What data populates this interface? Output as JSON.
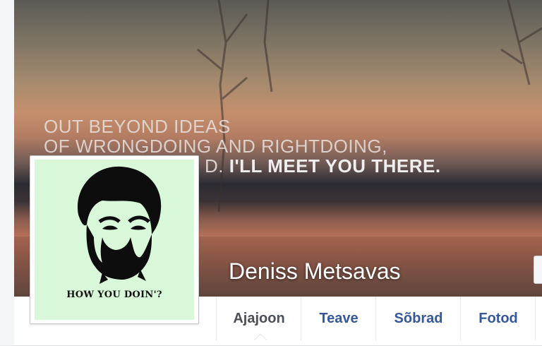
{
  "cover": {
    "quote_line_1": "OUT BEYOND IDEAS",
    "quote_line_2": "OF WRONGDOING AND RIGHTDOING,",
    "quote_line_3_faded": "D.",
    "quote_line_3_bold": "I'LL MEET YOU THERE."
  },
  "profile": {
    "name": "Deniss Metsavas",
    "avatar_caption": "HOW YOU DOIN'?"
  },
  "tabs": [
    {
      "label": "Ajajoon",
      "active": true
    },
    {
      "label": "Teave",
      "active": false
    },
    {
      "label": "Sõbrad",
      "active": false
    },
    {
      "label": "Fotod",
      "active": false
    }
  ],
  "colors": {
    "link_blue": "#365899",
    "active_tab_gray": "#4b4f56",
    "avatar_bg": "#d9f7d9"
  }
}
